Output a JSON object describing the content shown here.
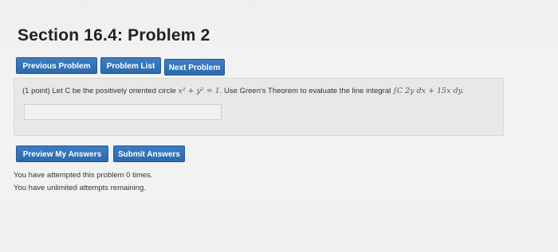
{
  "page": {
    "title": "Section 16.4: Problem 2"
  },
  "nav": {
    "previous_label": "Previous Problem",
    "list_label": "Problem List",
    "next_label": "Next Problem"
  },
  "problem": {
    "points": "(1 point)",
    "text_before": "Let C be the positively oriented circle",
    "circle_eq": "x² + y² = 1",
    "text_after": ". Use Green's Theorem to evaluate the line integral",
    "integral": "∫C 2y dx + 15x dy.",
    "answer_value": ""
  },
  "actions": {
    "preview_label": "Preview My Answers",
    "submit_label": "Submit Answers"
  },
  "status": {
    "attempts_text": "You have attempted this problem 0 times.",
    "remaining_text": "You have unlimited attempts remaining."
  },
  "colors": {
    "accent": "#2b69ac",
    "background": "#f2f2f2",
    "problem_box": "#e8e8e6"
  }
}
